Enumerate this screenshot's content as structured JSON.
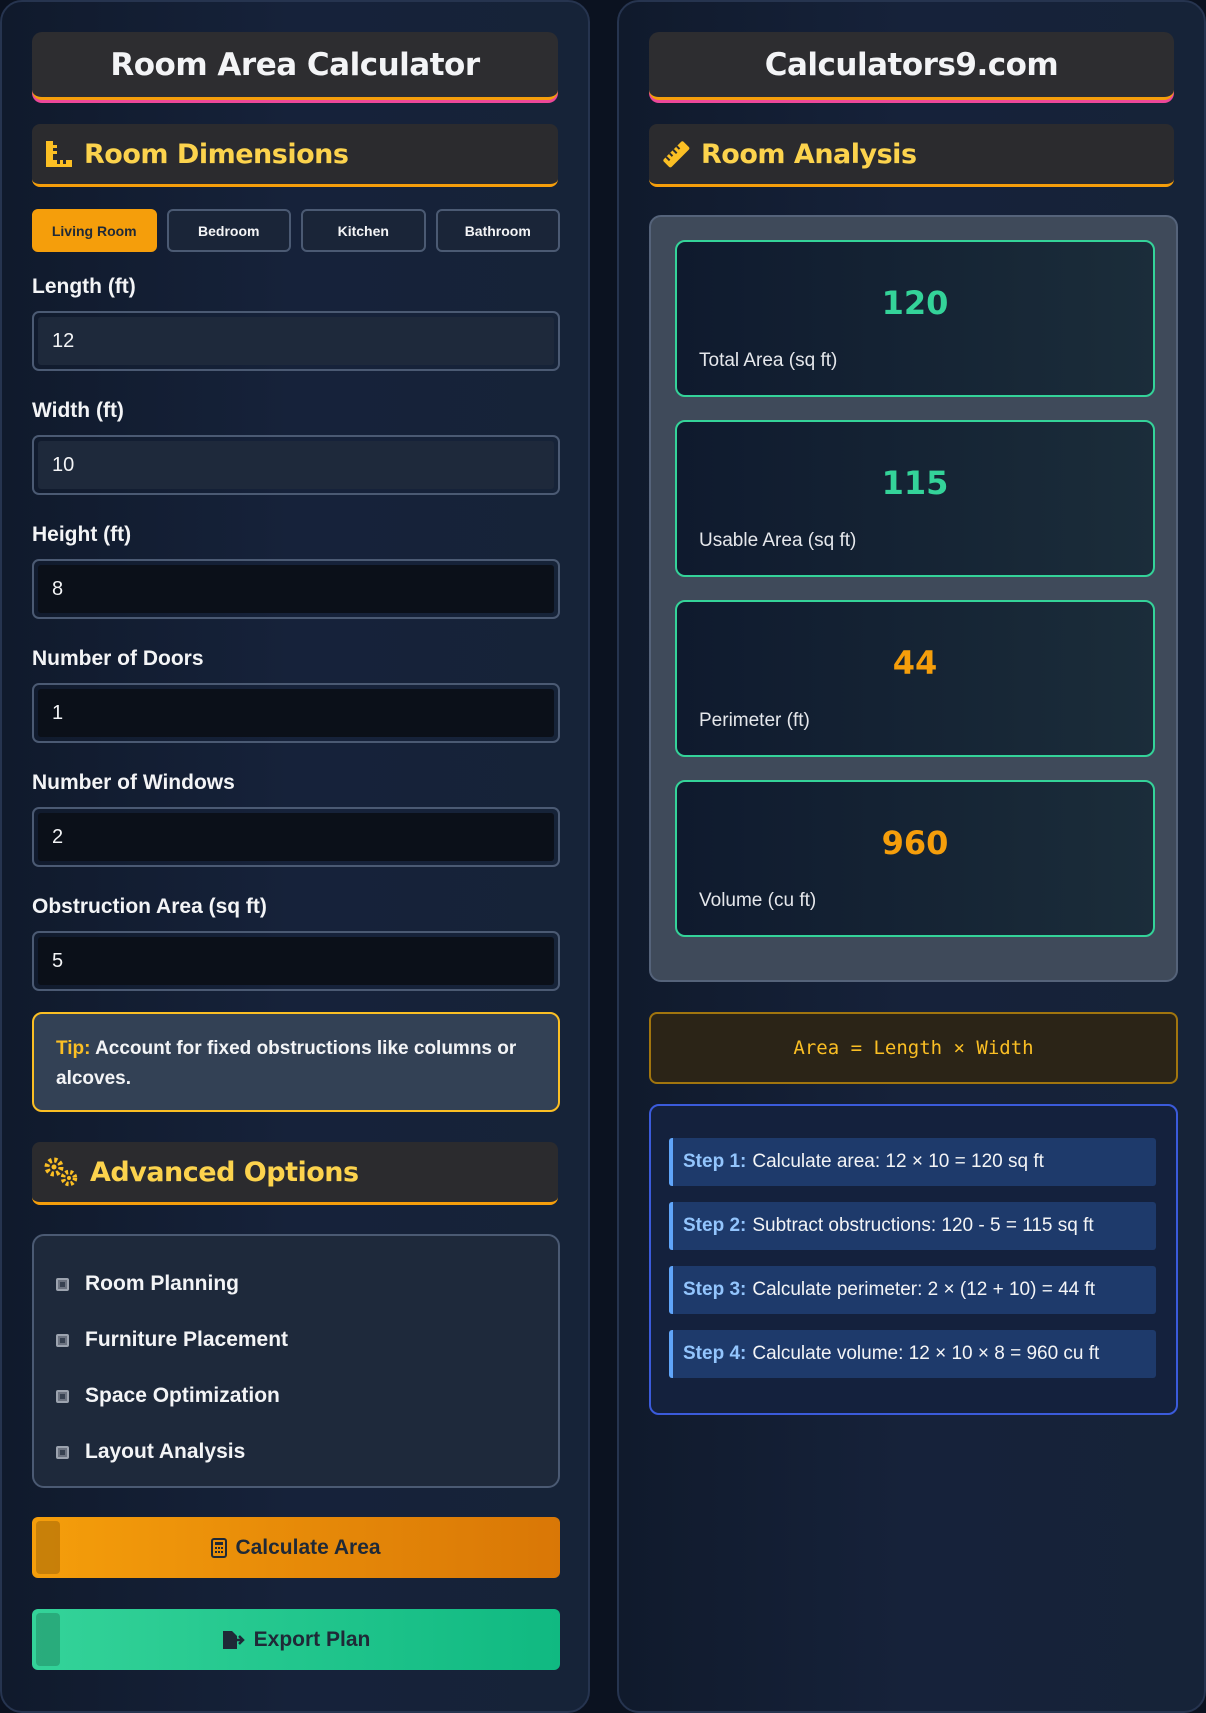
{
  "left": {
    "title": "Room Area Calculator",
    "dimensions_header": "Room Dimensions",
    "tabs": [
      {
        "label": "Living Room",
        "active": true
      },
      {
        "label": "Bedroom",
        "active": false
      },
      {
        "label": "Kitchen",
        "active": false
      },
      {
        "label": "Bathroom",
        "active": false
      }
    ],
    "fields": {
      "length": {
        "label": "Length (ft)",
        "value": "12"
      },
      "width": {
        "label": "Width (ft)",
        "value": "10"
      },
      "height": {
        "label": "Height (ft)",
        "value": "8"
      },
      "doors": {
        "label": "Number of Doors",
        "value": "1"
      },
      "windows": {
        "label": "Number of Windows",
        "value": "2"
      },
      "obstruction": {
        "label": "Obstruction Area (sq ft)",
        "value": "5"
      }
    },
    "tip": {
      "key": "Tip:",
      "text": "Account for fixed obstructions like columns or alcoves."
    },
    "advanced_header": "Advanced Options",
    "options": [
      "Room Planning",
      "Furniture Placement",
      "Space Optimization",
      "Layout Analysis"
    ],
    "calculate_label": "Calculate Area",
    "export_label": "Export Plan"
  },
  "right": {
    "title": "Calculators9.com",
    "analysis_header": "Room Analysis",
    "stats": [
      {
        "value": "120",
        "label": "Total Area (sq ft)",
        "color": "#34d399"
      },
      {
        "value": "115",
        "label": "Usable Area (sq ft)",
        "color": "#34d399"
      },
      {
        "value": "44",
        "label": "Perimeter (ft)",
        "color": "#f59e0b"
      },
      {
        "value": "960",
        "label": "Volume (cu ft)",
        "color": "#f59e0b"
      }
    ],
    "formula": "Area = Length × Width",
    "steps": [
      {
        "key": "Step 1:",
        "text": "Calculate area: 12 × 10 = 120 sq ft"
      },
      {
        "key": "Step 2:",
        "text": "Subtract obstructions: 120 - 5 = 115 sq ft"
      },
      {
        "key": "Step 3:",
        "text": "Calculate perimeter: 2 × (12 + 10) = 44 ft"
      },
      {
        "key": "Step 4:",
        "text": "Calculate volume: 12 × 10 × 8 = 960 cu ft"
      }
    ]
  }
}
